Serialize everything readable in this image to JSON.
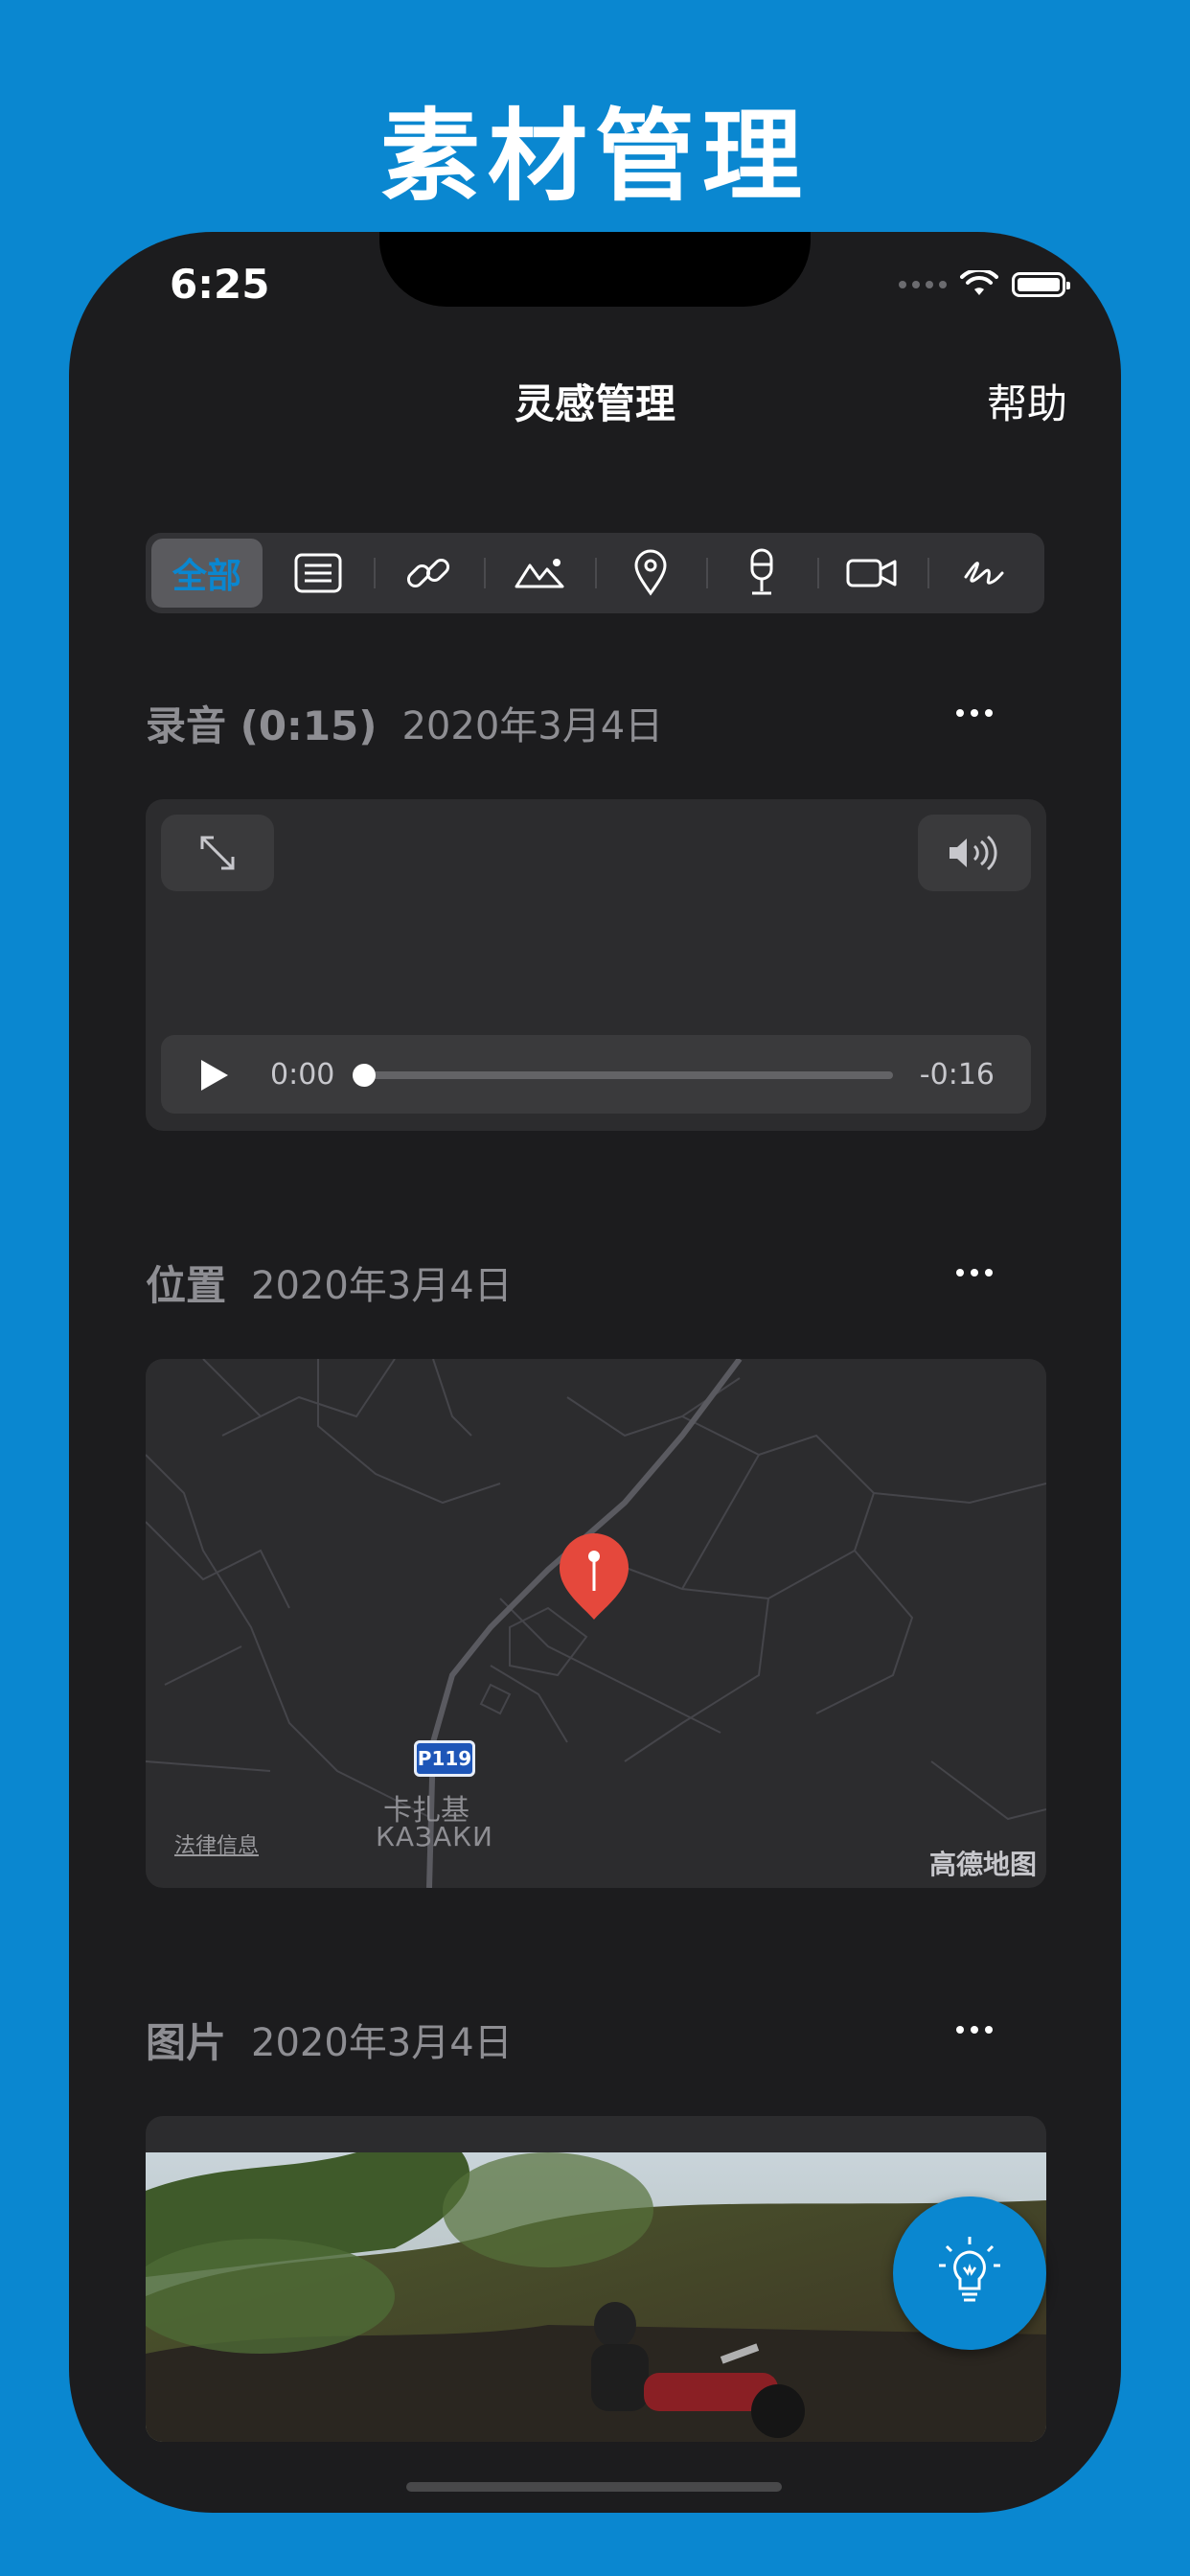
{
  "promo": {
    "title": "素材管理"
  },
  "status_bar": {
    "time": "6:25"
  },
  "nav": {
    "title": "灵感管理",
    "help": "帮助"
  },
  "filter_tabs": [
    {
      "label": "全部",
      "icon": "all",
      "selected": true
    },
    {
      "icon": "text-icon"
    },
    {
      "icon": "link-icon"
    },
    {
      "icon": "image-icon"
    },
    {
      "icon": "location-icon"
    },
    {
      "icon": "microphone-icon"
    },
    {
      "icon": "video-icon"
    },
    {
      "icon": "scribble-icon"
    }
  ],
  "sections": {
    "audio": {
      "title": "录音 (0:15)",
      "date": "2020年3月4日",
      "player": {
        "current": "0:00",
        "remaining": "-0:16",
        "progress": 0
      }
    },
    "location": {
      "title": "位置",
      "date": "2020年3月4日",
      "map": {
        "road_shield": "P119",
        "place_cn": "卡扎基",
        "place_ru": "КАЗАКИ",
        "legal": "法律信息",
        "logo": "高德地图"
      }
    },
    "image": {
      "title": "图片",
      "date": "2020年3月4日"
    }
  },
  "colors": {
    "accent": "#0a87d0",
    "card": "#2c2c2e",
    "background": "#1c1c1e",
    "pin": "#e5483c"
  }
}
